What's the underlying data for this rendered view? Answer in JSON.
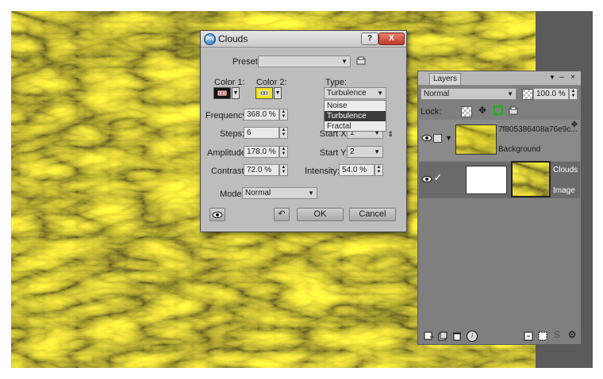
{
  "dialog": {
    "title": "Clouds",
    "help_label": "?",
    "close_label": "X",
    "preset_label": "Preset:",
    "preset_value": "",
    "color1_label": "Color 1:",
    "color2_label": "Color 2:",
    "type_label": "Type:",
    "type_value": "Turbulence",
    "type_options": [
      "Noise",
      "Turbulence",
      "Fractal"
    ],
    "frequency_label": "Frequency:",
    "frequency_value": "368.0 %",
    "steps_label": "Steps:",
    "steps_value": "6",
    "startx_label": "Start X:",
    "startx_value": "1",
    "amplitude_label": "Amplitude:",
    "amplitude_value": "178.0 %",
    "starty_label": "Start Y:",
    "starty_value": "2",
    "contrast_label": "Contrast:",
    "contrast_value": "72.0 %",
    "intensity_label": "Intensity:",
    "intensity_value": "54.0 %",
    "mode_label": "Mode:",
    "mode_value": "Normal",
    "ok_label": "OK",
    "cancel_label": "Cancel",
    "color1": "#111111",
    "color2": "#f2e21a"
  },
  "layers": {
    "tab_label": "Layers",
    "blend_mode": "Normal",
    "opacity": "100.0 %",
    "lock_label": "Lock:",
    "layer1_name": "7f805386408a76e9c...",
    "layer1_sub": "Background",
    "layer2_name": "Clouds",
    "layer2_sub": "Image"
  },
  "colors": {
    "canvas_yellow": "#e8d81c",
    "canvas_dark": "#5e5a12",
    "selected_row": "#6a6a6a"
  }
}
